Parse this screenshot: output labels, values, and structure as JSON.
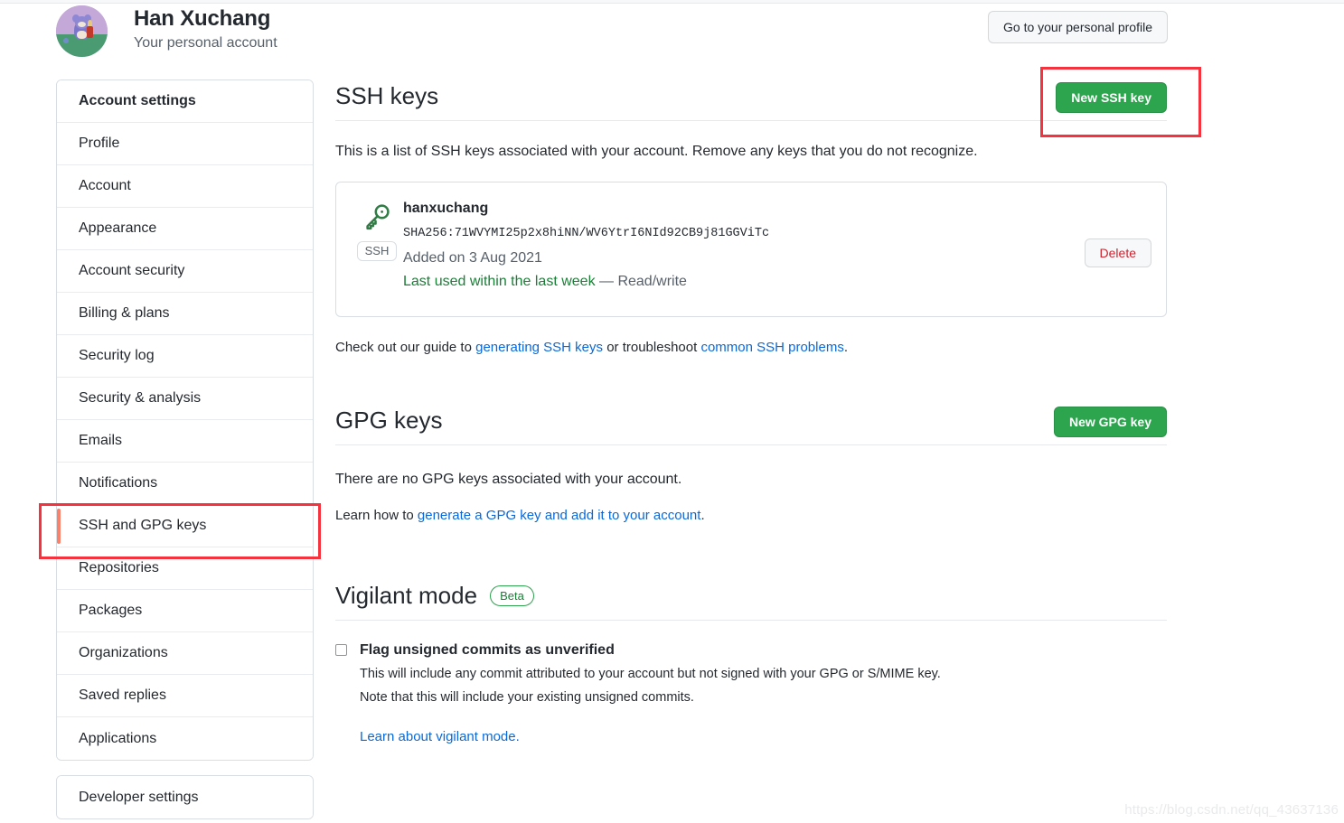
{
  "header": {
    "account_name": "Han Xuchang",
    "account_subtitle": "Your personal account",
    "profile_button": "Go to your personal profile",
    "avatar_name": "user-avatar-cartoon-mouse"
  },
  "sidebar": {
    "groups": [
      {
        "items": [
          {
            "label": "Account settings",
            "kind": "heading",
            "active": false
          },
          {
            "label": "Profile",
            "kind": "link",
            "active": false
          },
          {
            "label": "Account",
            "kind": "link",
            "active": false
          },
          {
            "label": "Appearance",
            "kind": "link",
            "active": false
          },
          {
            "label": "Account security",
            "kind": "link",
            "active": false
          },
          {
            "label": "Billing & plans",
            "kind": "link",
            "active": false
          },
          {
            "label": "Security log",
            "kind": "link",
            "active": false
          },
          {
            "label": "Security & analysis",
            "kind": "link",
            "active": false
          },
          {
            "label": "Emails",
            "kind": "link",
            "active": false
          },
          {
            "label": "Notifications",
            "kind": "link",
            "active": false
          },
          {
            "label": "SSH and GPG keys",
            "kind": "link",
            "active": true
          },
          {
            "label": "Repositories",
            "kind": "link",
            "active": false
          },
          {
            "label": "Packages",
            "kind": "link",
            "active": false
          },
          {
            "label": "Organizations",
            "kind": "link",
            "active": false
          },
          {
            "label": "Saved replies",
            "kind": "link",
            "active": false
          },
          {
            "label": "Applications",
            "kind": "link",
            "active": false
          }
        ]
      },
      {
        "items": [
          {
            "label": "Developer settings",
            "kind": "link",
            "active": false
          }
        ]
      }
    ]
  },
  "ssh_section": {
    "title": "SSH keys",
    "new_key_button": "New SSH key",
    "description": "This is a list of SSH keys associated with your account. Remove any keys that you do not recognize.",
    "key": {
      "icon_name": "key-icon",
      "type_badge": "SSH",
      "title": "hanxuchang",
      "fingerprint": "SHA256:71WVYMI25p2x8hiNN/WV6YtrI6NId92CB9j81GGViTc",
      "added": "Added on 3 Aug 2021",
      "last_used": "Last used within the last week",
      "access": " — Read/write",
      "delete_button": "Delete"
    },
    "guide_prefix": "Check out our guide to ",
    "guide_link_1": "generating SSH keys",
    "guide_middle": " or troubleshoot ",
    "guide_link_2": "common SSH problems",
    "guide_suffix": "."
  },
  "gpg_section": {
    "title": "GPG keys",
    "new_key_button": "New GPG key",
    "empty_text": "There are no GPG keys associated with your account.",
    "learn_prefix": "Learn how to ",
    "learn_link": "generate a GPG key and add it to your account",
    "learn_suffix": "."
  },
  "vigilant_section": {
    "title": "Vigilant mode",
    "badge": "Beta",
    "checkbox_label": "Flag unsigned commits as unverified",
    "checkbox_checked": false,
    "note_line_1": "This will include any commit attributed to your account but not signed with your GPG or S/MIME key.",
    "note_line_2": "Note that this will include your existing unsigned commits.",
    "learn_link": "Learn about vigilant mode."
  },
  "annotations": {
    "color": "#f5333f",
    "boxes": [
      "new-ssh-key-button",
      "sidebar-item-ssh-and-gpg-keys"
    ]
  },
  "watermark": "https://blog.csdn.net/qq_43637136"
}
